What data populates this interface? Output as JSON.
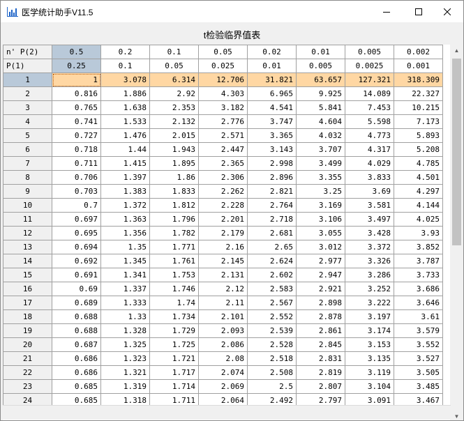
{
  "window": {
    "title": "医学统计助手V11.5",
    "icon": "bar-chart-icon",
    "controls": [
      "minimize-icon",
      "maximize-icon",
      "close-icon"
    ]
  },
  "caption": "t检验临界值表",
  "header_rows": [
    [
      "n' P(2)",
      "0.5",
      "0.2",
      "0.1",
      "0.05",
      "0.02",
      "0.01",
      "0.005",
      "0.002"
    ],
    [
      "P(1)",
      "0.25",
      "0.1",
      "0.05",
      "0.025",
      "0.01",
      "0.005",
      "0.0025",
      "0.001"
    ]
  ],
  "rows": [
    [
      "1",
      "1",
      "3.078",
      "6.314",
      "12.706",
      "31.821",
      "63.657",
      "127.321",
      "318.309"
    ],
    [
      "2",
      "0.816",
      "1.886",
      "2.92",
      "4.303",
      "6.965",
      "9.925",
      "14.089",
      "22.327"
    ],
    [
      "3",
      "0.765",
      "1.638",
      "2.353",
      "3.182",
      "4.541",
      "5.841",
      "7.453",
      "10.215"
    ],
    [
      "4",
      "0.741",
      "1.533",
      "2.132",
      "2.776",
      "3.747",
      "4.604",
      "5.598",
      "7.173"
    ],
    [
      "5",
      "0.727",
      "1.476",
      "2.015",
      "2.571",
      "3.365",
      "4.032",
      "4.773",
      "5.893"
    ],
    [
      "6",
      "0.718",
      "1.44",
      "1.943",
      "2.447",
      "3.143",
      "3.707",
      "4.317",
      "5.208"
    ],
    [
      "7",
      "0.711",
      "1.415",
      "1.895",
      "2.365",
      "2.998",
      "3.499",
      "4.029",
      "4.785"
    ],
    [
      "8",
      "0.706",
      "1.397",
      "1.86",
      "2.306",
      "2.896",
      "3.355",
      "3.833",
      "4.501"
    ],
    [
      "9",
      "0.703",
      "1.383",
      "1.833",
      "2.262",
      "2.821",
      "3.25",
      "3.69",
      "4.297"
    ],
    [
      "10",
      "0.7",
      "1.372",
      "1.812",
      "2.228",
      "2.764",
      "3.169",
      "3.581",
      "4.144"
    ],
    [
      "11",
      "0.697",
      "1.363",
      "1.796",
      "2.201",
      "2.718",
      "3.106",
      "3.497",
      "4.025"
    ],
    [
      "12",
      "0.695",
      "1.356",
      "1.782",
      "2.179",
      "2.681",
      "3.055",
      "3.428",
      "3.93"
    ],
    [
      "13",
      "0.694",
      "1.35",
      "1.771",
      "2.16",
      "2.65",
      "3.012",
      "3.372",
      "3.852"
    ],
    [
      "14",
      "0.692",
      "1.345",
      "1.761",
      "2.145",
      "2.624",
      "2.977",
      "3.326",
      "3.787"
    ],
    [
      "15",
      "0.691",
      "1.341",
      "1.753",
      "2.131",
      "2.602",
      "2.947",
      "3.286",
      "3.733"
    ],
    [
      "16",
      "0.69",
      "1.337",
      "1.746",
      "2.12",
      "2.583",
      "2.921",
      "3.252",
      "3.686"
    ],
    [
      "17",
      "0.689",
      "1.333",
      "1.74",
      "2.11",
      "2.567",
      "2.898",
      "3.222",
      "3.646"
    ],
    [
      "18",
      "0.688",
      "1.33",
      "1.734",
      "2.101",
      "2.552",
      "2.878",
      "3.197",
      "3.61"
    ],
    [
      "19",
      "0.688",
      "1.328",
      "1.729",
      "2.093",
      "2.539",
      "2.861",
      "3.174",
      "3.579"
    ],
    [
      "20",
      "0.687",
      "1.325",
      "1.725",
      "2.086",
      "2.528",
      "2.845",
      "3.153",
      "3.552"
    ],
    [
      "21",
      "0.686",
      "1.323",
      "1.721",
      "2.08",
      "2.518",
      "2.831",
      "3.135",
      "3.527"
    ],
    [
      "22",
      "0.686",
      "1.321",
      "1.717",
      "2.074",
      "2.508",
      "2.819",
      "3.119",
      "3.505"
    ],
    [
      "23",
      "0.685",
      "1.319",
      "1.714",
      "2.069",
      "2.5",
      "2.807",
      "3.104",
      "3.485"
    ],
    [
      "24",
      "0.685",
      "1.318",
      "1.711",
      "2.064",
      "2.492",
      "2.797",
      "3.091",
      "3.467"
    ]
  ],
  "colors": {
    "selected_header": "#b9c9d9",
    "selected_row": "#ffd7a3",
    "grid_line": "#a0a0a0",
    "app_icon": "#1e64c8"
  }
}
